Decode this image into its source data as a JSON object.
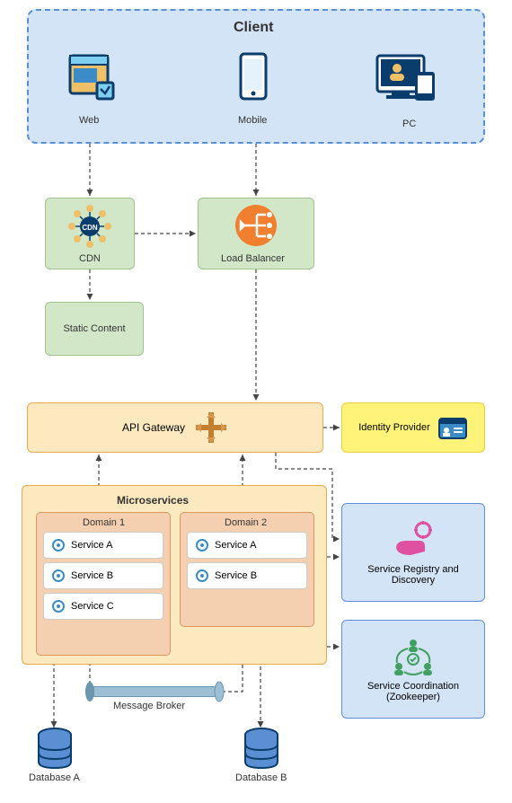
{
  "client": {
    "title": "Client",
    "web": "Web",
    "mobile": "Mobile",
    "pc": "PC"
  },
  "cdn": "CDN",
  "loadBalancer": "Load Balancer",
  "staticContent": "Static Content",
  "apiGateway": "API Gateway",
  "identityProvider": "Identity Provider",
  "microservices": {
    "title": "Microservices",
    "domain1": {
      "title": "Domain 1",
      "services": [
        "Service A",
        "Service B",
        "Service C"
      ]
    },
    "domain2": {
      "title": "Domain 2",
      "services": [
        "Service A",
        "Service B"
      ]
    }
  },
  "registry": "Service Registry and Discovery",
  "coordination": "Service Coordination (Zookeeper)",
  "messageBroker": "Message Broker",
  "dbA": "Database A",
  "dbB": "Database B"
}
